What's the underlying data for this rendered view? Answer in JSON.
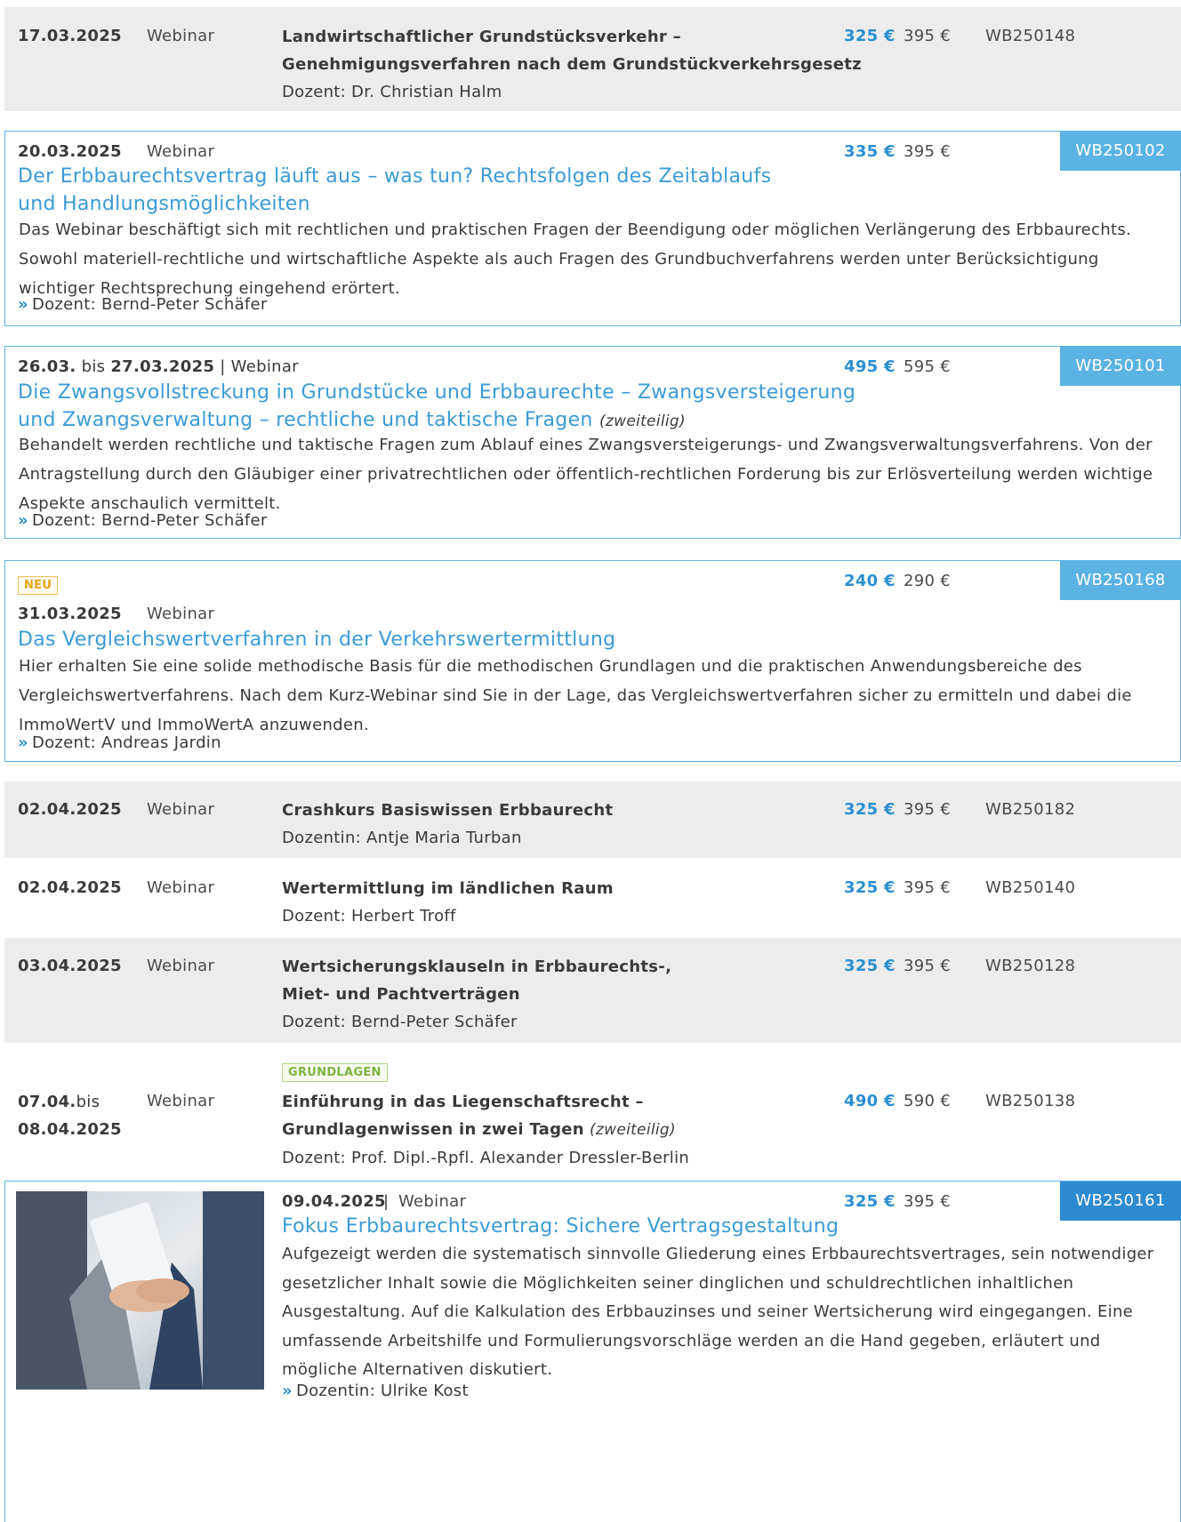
{
  "rows": {
    "r1": {
      "date": "17.03.2025",
      "format": "Webinar",
      "title_l1": "Landwirtschaftlicher Grundstücksverkehr –",
      "title_l2": "Genehmigungsverfahren nach dem Grundstückverkehrsgesetz",
      "lecturer": "Dozent: Dr. Christian Halm",
      "price_member": "325 €",
      "price_regular": "395 €",
      "code": "WB250148"
    },
    "r2": {
      "date": "20.03.2025",
      "format": "Webinar",
      "title_l1": "Der Erbbaurechtsvertrag läuft aus – was tun? Rechtsfolgen des Zeitablaufs",
      "title_l2": "und Handlungsmöglichkeiten",
      "description": "Das Webinar beschäftigt sich mit rechtlichen und praktischen Fragen der Beendigung oder möglichen Verlängerung des Erbbaurechts. Sowohl materiell-rechtliche und wirtschaftliche Aspekte als auch Fragen des Grundbuchverfahrens werden unter Berücksichtigung wichtiger Rechtsprechung eingehend erörtert.",
      "lecturer": "Dozent: Bernd-Peter Schäfer",
      "price_member": "335 €",
      "price_regular": "395 €",
      "code": "WB250102"
    },
    "r3": {
      "date_from": "26.03.",
      "bis": "bis",
      "date_to": "27.03.2025",
      "sep": "|",
      "format": "Webinar",
      "title_l1": "Die Zwangsvollstreckung in Grundstücke und Erbbaurechte – Zwangsversteigerung",
      "title_l2": "und Zwangsverwaltung – rechtliche und taktische Fragen",
      "title_note": "(zweiteilig)",
      "description": "Behandelt werden rechtliche und taktische Fragen zum Ablauf eines Zwangsversteigerungs- und Zwangsverwaltungsverfahrens. Von der Antragstellung durch den Gläubiger einer privatrechtlichen oder öffentlich-rechtlichen Forderung bis zur Erlösverteilung werden wichtige Aspekte anschaulich vermittelt.",
      "lecturer": "Dozent: Bernd-Peter Schäfer",
      "price_member": "495 €",
      "price_regular": "595 €",
      "code": "WB250101"
    },
    "r4": {
      "badge": "NEU",
      "date": "31.03.2025",
      "format": "Webinar",
      "title": "Das Vergleichswertverfahren in der Verkehrswertermittlung",
      "description": "Hier erhalten Sie eine solide methodische Basis für die methodischen Grundlagen und die praktischen Anwendungsbereiche des Vergleichswertverfahrens. Nach dem Kurz-Webinar sind Sie in der Lage, das Vergleichswertverfahren sicher zu ermitteln und dabei die ImmoWertV und ImmoWertA anzuwenden.",
      "lecturer": "Dozent: Andreas Jardin",
      "price_member": "240 €",
      "price_regular": "290 €",
      "code": "WB250168"
    },
    "r5": {
      "date": "02.04.2025",
      "format": "Webinar",
      "title_l1": "Crashkurs Basiswissen Erbbaurecht",
      "lecturer": "Dozentin: Antje Maria Turban",
      "price_member": "325 €",
      "price_regular": "395 €",
      "code": "WB250182"
    },
    "r6": {
      "date": "02.04.2025",
      "format": "Webinar",
      "title_l1": "Wertermittlung im ländlichen Raum",
      "lecturer": "Dozent: Herbert Troff",
      "price_member": "325 €",
      "price_regular": "395 €",
      "code": "WB250140"
    },
    "r7": {
      "date": "03.04.2025",
      "format": "Webinar",
      "title_l1": "Wertsicherungsklauseln in Erbbaurechts-,",
      "title_l2": "Miet- und Pachtverträgen",
      "lecturer": "Dozent: Bernd-Peter Schäfer",
      "price_member": "325 €",
      "price_regular": "395 €",
      "code": "WB250128"
    },
    "r8": {
      "badge": "GRUNDLAGEN",
      "date_from": "07.04.",
      "bis": "bis",
      "date_to": "08.04.2025",
      "format": "Webinar",
      "title_l1": "Einführung in das Liegenschaftsrecht –",
      "title_l2": "Grundlagenwissen in zwei Tagen",
      "title_note": "(zweiteilig)",
      "lecturer": "Dozent: Prof. Dipl.-Rpfl. Alexander Dressler-Berlin",
      "price_member": "490 €",
      "price_regular": "590 €",
      "code": "WB250138"
    },
    "r9": {
      "date": "09.04.2025",
      "sep": "|",
      "format": "Webinar",
      "title": "Fokus Erbbaurechtsvertrag: Sichere Vertragsgestaltung",
      "description": "Aufgezeigt werden die systematisch sinnvolle Gliederung eines Erbbaurechtsvertrages, sein notwendiger gesetzlicher Inhalt sowie die Möglichkeiten seiner dinglichen und schuldrechtlichen inhaltlichen Ausgestaltung. Auf die Kalkulation des Erbbauzinses und seiner Wertsicherung wird eingegangen. Eine umfassende Arbeitshilfe und Formulierungsvorschläge werden an die Hand gegeben, erläutert und mögliche Alternativen diskutiert.",
      "lecturer": "Dozentin: Ulrike Kost",
      "price_member": "325 €",
      "price_regular": "395 €",
      "code": "WB250161",
      "image_icon": "handshake-photo"
    }
  },
  "lecturer_arrow": "»",
  "colors": {
    "accent": "#3a9bd5",
    "code_box": "#5bb3e4",
    "code_box_dark": "#2c8bd0",
    "row_gray": "#ececec",
    "badge_new": "#e8a317",
    "badge_basics": "#7cb342"
  }
}
